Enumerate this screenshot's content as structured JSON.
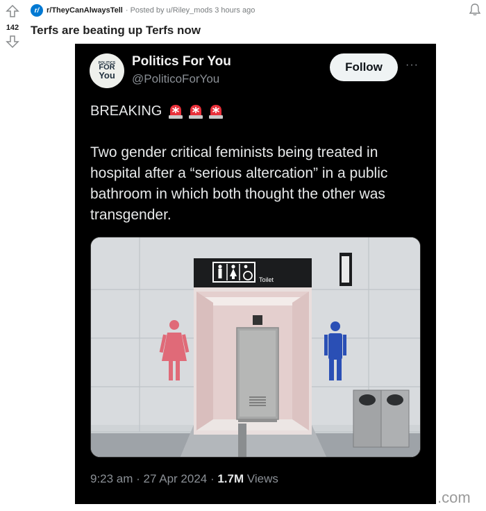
{
  "post": {
    "score": "142",
    "subreddit": "r/TheyCanAlwaysTell",
    "subreddit_icon": "r/",
    "posted_by": "· Posted by u/Riley_mods 3 hours ago",
    "title": "Terfs are beating up Terfs now",
    "icons": [
      "upvote-arrow-icon",
      "downvote-arrow-icon",
      "bell-icon",
      "subreddit-icon"
    ]
  },
  "tweet": {
    "avatar": {
      "line1": "POLITICS",
      "line2": "FOR",
      "line3": "You"
    },
    "name": "Politics For You",
    "handle": "@PoliticoForYou",
    "follow_label": "Follow",
    "more_label": "···",
    "breaking": "BREAKING",
    "siren_icons": [
      "siren-icon",
      "siren-icon",
      "siren-icon"
    ],
    "text": "Two gender critical feminists being treated in hospital after a “serious altercation” in a public bathroom in which both thought the other was transgender.",
    "photo": {
      "sign_label": "Toilet"
    },
    "time": "9:23 am · 27 Apr 2024 · ",
    "views_count": "1.7M",
    "views_label": " Views"
  },
  "watermark": ".com",
  "colors": {
    "tweet_bg": "#000000",
    "follow_bg": "#eff3f4",
    "subreddit_blue": "#0079d3",
    "female_sign": "#e06a78",
    "male_sign": "#2a4fb5"
  }
}
